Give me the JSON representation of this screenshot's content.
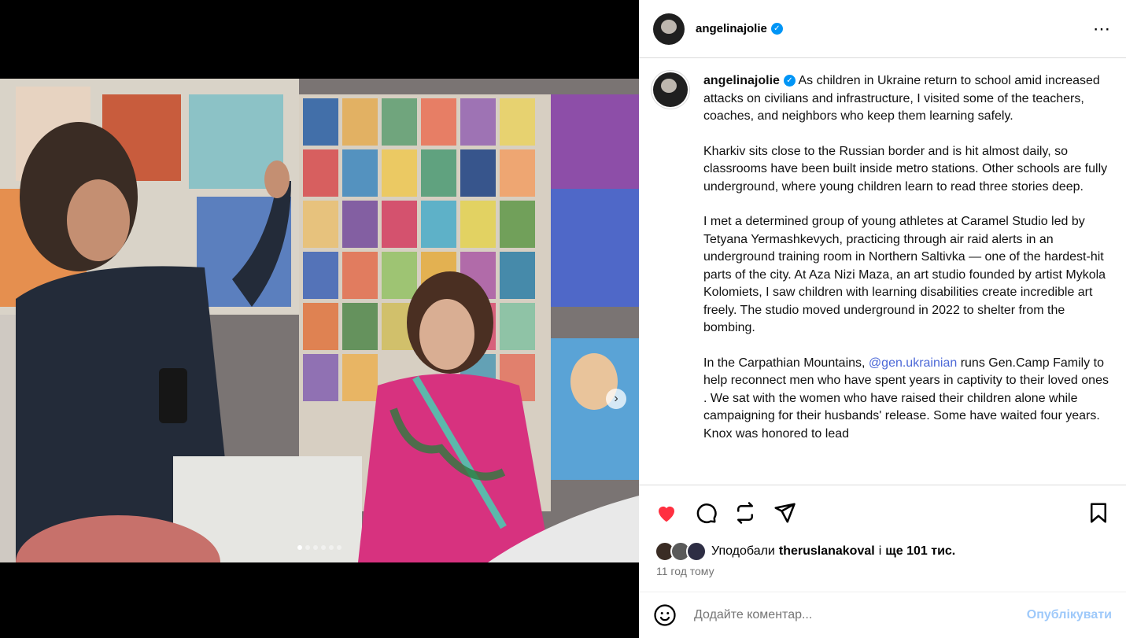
{
  "post": {
    "username": "angelinajolie",
    "caption_p1": "As children in Ukraine return to school amid increased attacks on civilians and infrastructure, I visited some of the teachers, coaches, and neighbors who keep them learning safely.",
    "caption_p2": "Kharkiv sits close to the Russian border and is hit almost daily, so classrooms have been built inside metro stations. Other schools are fully underground, where young children learn to read three stories deep.",
    "caption_p3": "I met a determined group of young athletes at Caramel Studio led by Tetyana Yermashkevych, practicing through air raid alerts in an underground training room in Northern Saltivka — one of the hardest-hit parts of the city. At Aza Nizi Maza, an art studio founded by artist Mykola Kolomiets, I saw children with learning disabilities create incredible art freely. The studio moved underground in 2022 to shelter from the bombing.",
    "caption_p4_before": "In the Carpathian Mountains,",
    "mention": "@gen.ukrainian",
    "caption_p4_after": "runs Gen.Camp Family to help reconnect men who have spent years in captivity to their loved ones . We sat with the women who have raised their children alone while campaigning for their husbands' release. Some have waited four years. Knox was honored to lead",
    "likes_prefix": "Уподобали",
    "likes_user": "theruslanakoval",
    "likes_connector": "і",
    "likes_rest": "ще 101 тис.",
    "time": "11 год тому",
    "comment_placeholder": "Додайте коментар...",
    "publish": "Опублікувати"
  },
  "colors": {
    "accent": "#0095f6",
    "like": "#ff3040",
    "mention": "#4c68d7",
    "publish_disabled": "#9ec9fa"
  },
  "icons": [
    "verified-icon",
    "more-options-icon",
    "heart-icon",
    "comment-icon",
    "repost-icon",
    "share-icon",
    "bookmark-icon",
    "emoji-icon",
    "next-arrow-icon"
  ]
}
